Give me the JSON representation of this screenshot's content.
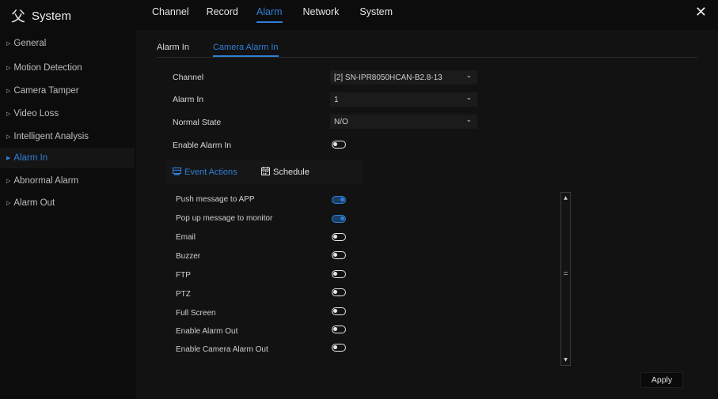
{
  "app": {
    "title": "System",
    "logo_glyph": "⽗"
  },
  "colors": {
    "accent": "#2f7fd6",
    "background": "#0c0c0c",
    "panel": "#121212"
  },
  "top_tabs": [
    {
      "label": "Channel",
      "active": false
    },
    {
      "label": "Record",
      "active": false
    },
    {
      "label": "Alarm",
      "active": true
    },
    {
      "label": "Network",
      "active": false
    },
    {
      "label": "System",
      "active": false
    }
  ],
  "close_icon": "✕",
  "sidebar": {
    "items": [
      {
        "label": "General",
        "active": false
      },
      {
        "label": "Motion Detection",
        "active": false
      },
      {
        "label": "Camera Tamper",
        "active": false
      },
      {
        "label": "Video Loss",
        "active": false
      },
      {
        "label": "Intelligent Analysis",
        "active": false
      },
      {
        "label": "Alarm In",
        "active": true
      },
      {
        "label": "Abnormal Alarm",
        "active": false
      },
      {
        "label": "Alarm Out",
        "active": false
      }
    ]
  },
  "sub_tabs": [
    {
      "label": "Alarm In",
      "active": false
    },
    {
      "label": "Camera Alarm In",
      "active": true
    }
  ],
  "form": {
    "channel": {
      "label": "Channel",
      "value": "[2] SN-IPR8050HCAN-B2.8-13"
    },
    "alarm_in": {
      "label": "Alarm In",
      "value": "1"
    },
    "normal_state": {
      "label": "Normal State",
      "value": "N/O"
    },
    "enable_alarm_in": {
      "label": "Enable Alarm In",
      "on": false
    }
  },
  "action_tabs": [
    {
      "label": "Event Actions",
      "icon": "event-actions-icon",
      "active": true
    },
    {
      "label": "Schedule",
      "icon": "calendar-icon",
      "active": false
    }
  ],
  "actions": [
    {
      "label": "Push message to APP",
      "on": true
    },
    {
      "label": "Pop up message to monitor",
      "on": true
    },
    {
      "label": "Email",
      "on": false
    },
    {
      "label": "Buzzer",
      "on": false
    },
    {
      "label": "FTP",
      "on": false
    },
    {
      "label": "PTZ",
      "on": false
    },
    {
      "label": "Full Screen",
      "on": false
    },
    {
      "label": "Enable Alarm Out",
      "on": false
    },
    {
      "label": "Enable Camera Alarm Out",
      "on": false
    }
  ],
  "apply_label": "Apply"
}
